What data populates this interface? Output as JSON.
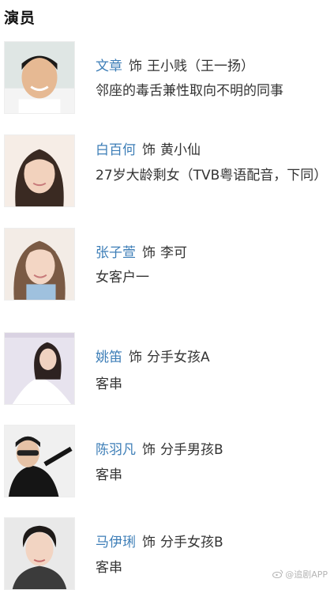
{
  "section": {
    "title": "演员"
  },
  "as_word": "饰",
  "cast": [
    {
      "actor": "文章",
      "role": "王小贱（王一扬）",
      "description": "邻座的毒舌兼性取向不明的同事"
    },
    {
      "actor": "白百何",
      "role": "黄小仙",
      "description": "27岁大龄剩女（TVB粤语配音，下同）"
    },
    {
      "actor": "张子萱",
      "role": "李可",
      "description": "女客户一"
    },
    {
      "actor": "姚笛",
      "role": "分手女孩A",
      "description": "客串"
    },
    {
      "actor": "陈羽凡",
      "role": "分手男孩B",
      "description": "客串"
    },
    {
      "actor": "马伊琍",
      "role": "分手女孩B",
      "description": "客串"
    }
  ],
  "watermark": {
    "text": "@追剧APP"
  }
}
